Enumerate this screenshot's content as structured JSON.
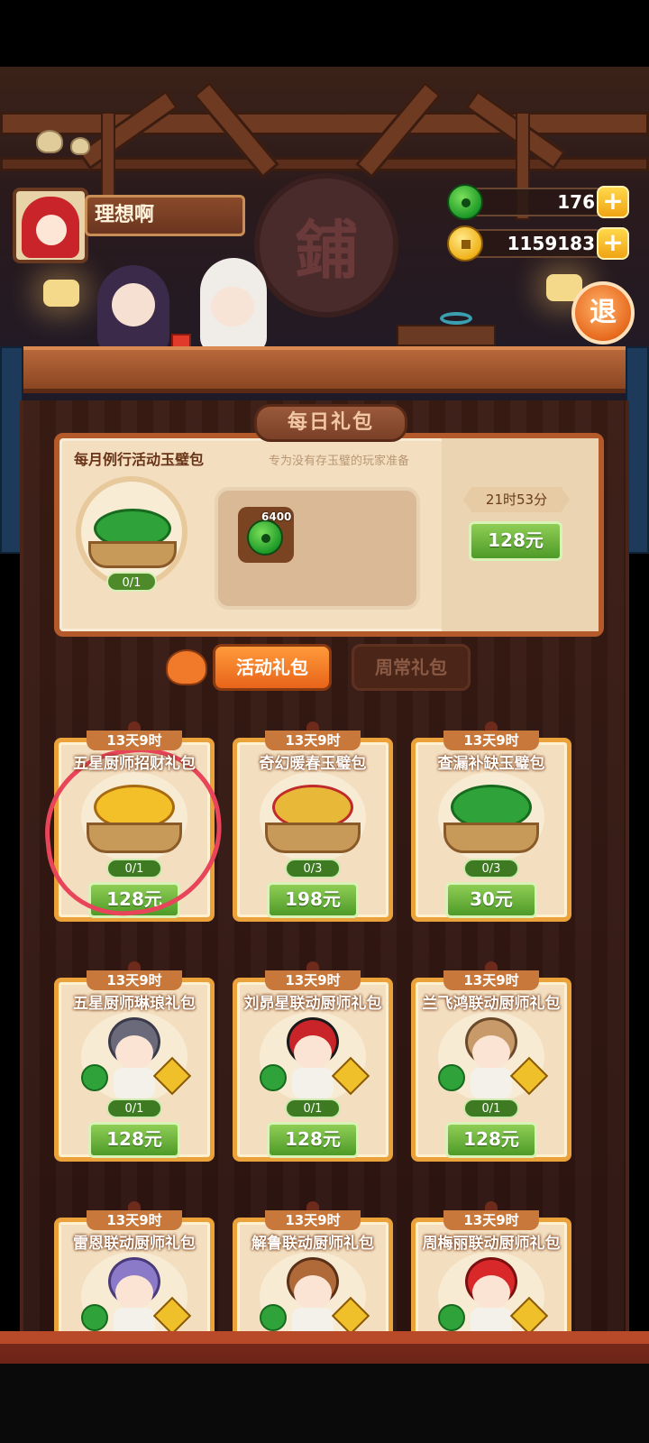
{
  "player": {
    "name": "理想啊"
  },
  "currency": {
    "jade": "176",
    "coins": "1159183"
  },
  "sign_char": "鋪",
  "exit_label": "退",
  "daily": {
    "header": "每日礼包",
    "title": "每月例行活动玉璧包",
    "subtitle": "专为没有存玉璧的玩家准备",
    "progress": "0/1",
    "item_qty": "6400",
    "timer": "21时53分",
    "price": "128元"
  },
  "tabs": {
    "active": "活动礼包",
    "inactive": "周常礼包"
  },
  "cards": [
    {
      "time": "13天9时",
      "title": "五星厨师招财礼包",
      "progress": "0/1",
      "price": "128元",
      "art": "coin-basket"
    },
    {
      "time": "13天9时",
      "title": "奇幻暖春玉璧包",
      "progress": "0/3",
      "price": "198元",
      "art": "cheese-chest"
    },
    {
      "time": "13天9时",
      "title": "查漏补缺玉璧包",
      "progress": "0/3",
      "price": "30元",
      "art": "jade-basket"
    },
    {
      "time": "13天9时",
      "title": "五星厨师琳琅礼包",
      "progress": "0/1",
      "price": "128元",
      "art": "chef-grey"
    },
    {
      "time": "13天9时",
      "title": "刘昴星联动厨师礼包",
      "progress": "0/1",
      "price": "128元",
      "art": "chef-red"
    },
    {
      "time": "13天9时",
      "title": "兰飞鸿联动厨师礼包",
      "progress": "0/1",
      "price": "128元",
      "art": "chef-hat"
    },
    {
      "time": "13天9时",
      "title": "雷恩联动厨师礼包",
      "art": "chef-purple"
    },
    {
      "time": "13天9时",
      "title": "解鲁联动厨师礼包",
      "art": "chef-brown"
    },
    {
      "time": "13天9时",
      "title": "周梅丽联动厨师礼包",
      "art": "chef-redhair"
    }
  ],
  "colors": {
    "price_green": "#4e9a28",
    "frame_orange": "#eba23a",
    "annotation_red": "#e8445a"
  }
}
